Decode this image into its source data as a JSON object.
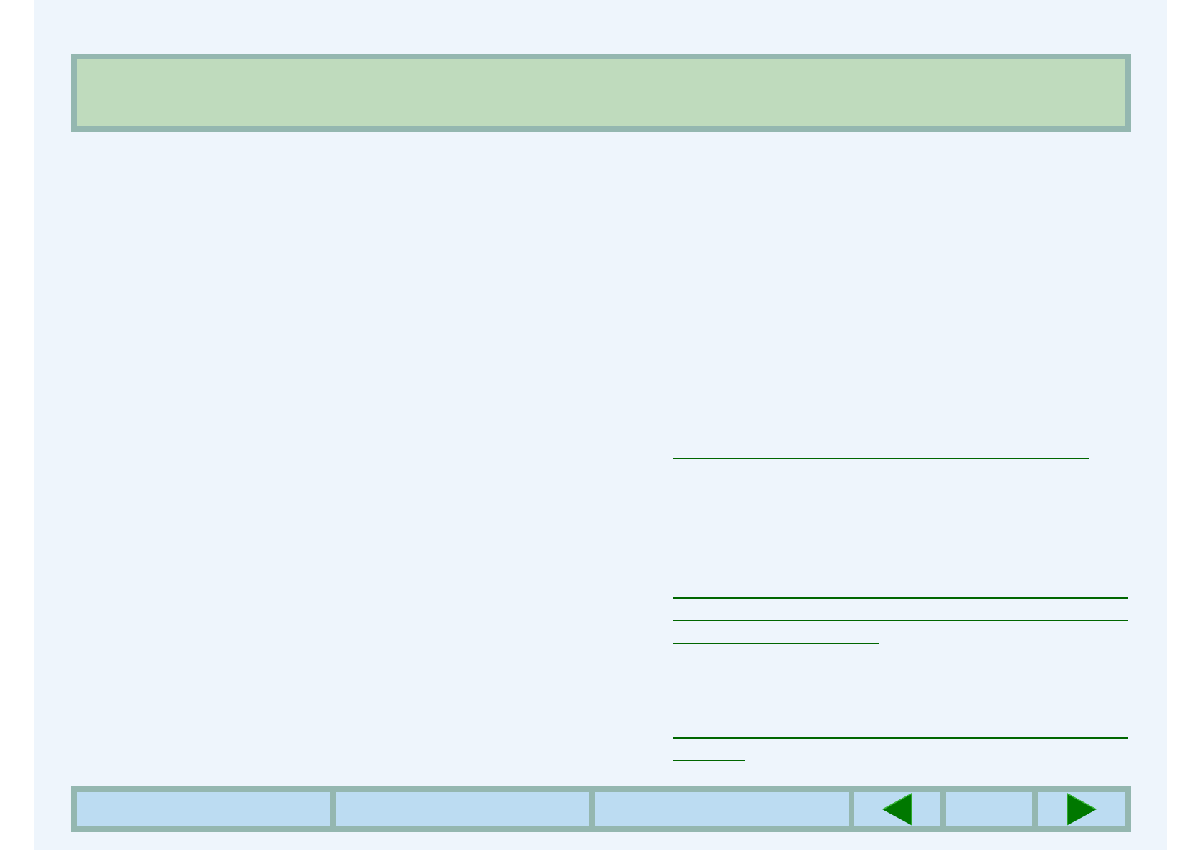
{
  "header_bar": {
    "kind": "banner"
  },
  "link_groups": [
    {
      "underlines": [
        {
          "kind": "long"
        }
      ]
    },
    {
      "underlines": [
        {
          "kind": "full"
        },
        {
          "kind": "full"
        },
        {
          "kind": "half"
        }
      ]
    },
    {
      "underlines": [
        {
          "kind": "full"
        },
        {
          "kind": "short"
        }
      ]
    }
  ],
  "nav_bar": [
    {
      "kind": "blank"
    },
    {
      "kind": "blank"
    },
    {
      "kind": "blank"
    },
    {
      "kind": "previous"
    },
    {
      "kind": "blank"
    },
    {
      "kind": "next"
    }
  ]
}
